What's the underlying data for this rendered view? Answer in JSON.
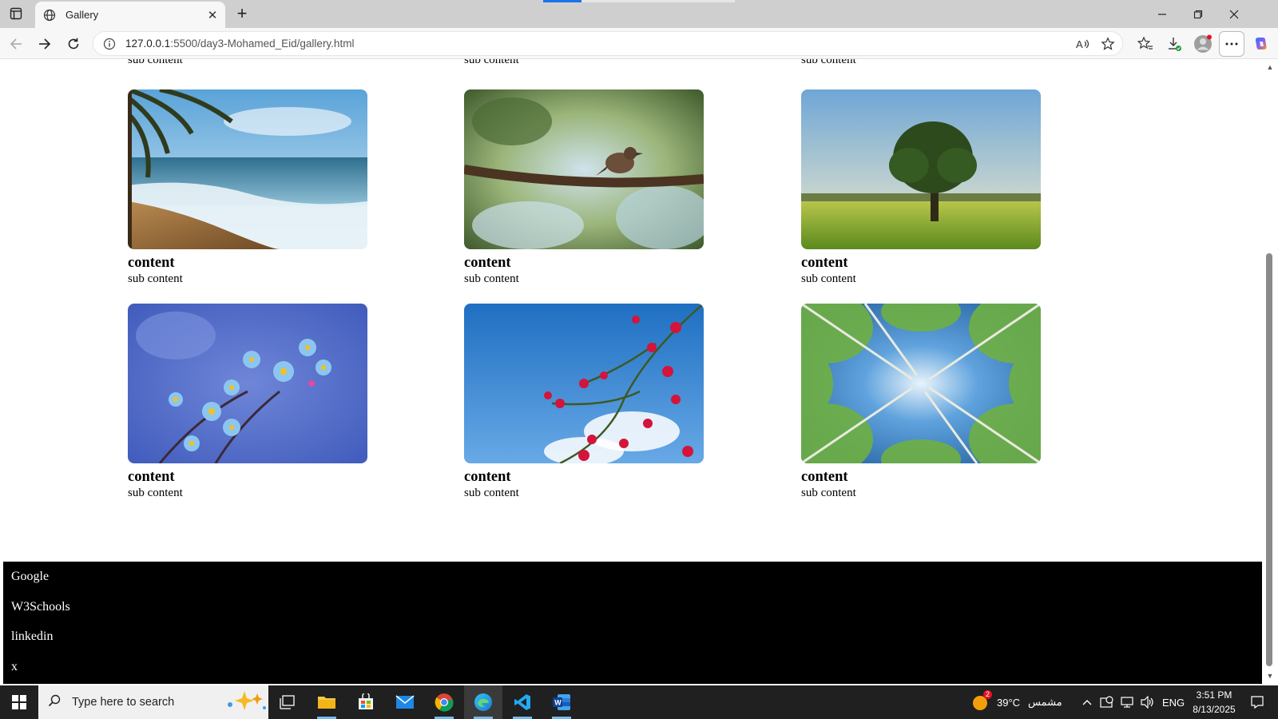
{
  "browser": {
    "tab_title": "Gallery",
    "url_host": "127.0.0.1",
    "url_path": ":5500/day3-Mohamed_Eid/gallery.html"
  },
  "page": {
    "partial_sub_label": "sub content",
    "cards": [
      {
        "heading": "content",
        "sub": "sub content",
        "image": "beach-palm-waves"
      },
      {
        "heading": "content",
        "sub": "sub content",
        "image": "bird-on-branch"
      },
      {
        "heading": "content",
        "sub": "sub content",
        "image": "tree-in-field"
      },
      {
        "heading": "content",
        "sub": "sub content",
        "image": "blue-forget-me-not-flowers"
      },
      {
        "heading": "content",
        "sub": "sub content",
        "image": "red-blossoms-blue-sky"
      },
      {
        "heading": "content",
        "sub": "sub content",
        "image": "forest-canopy-sky"
      }
    ],
    "footer_links": [
      "Google",
      "W3Schools",
      "linkedin",
      "x"
    ]
  },
  "taskbar": {
    "search_placeholder": "Type here to search",
    "weather_temp": "39°C",
    "weather_text": "مشمس",
    "weather_badge": "2",
    "language": "ENG",
    "time": "3:51 PM",
    "date": "8/13/2025"
  },
  "colors": {
    "footer_bg": "#000000",
    "footer_text": "#ffffff",
    "tabbar_bg": "#cfcfcf",
    "taskbar_bg": "#202020"
  }
}
